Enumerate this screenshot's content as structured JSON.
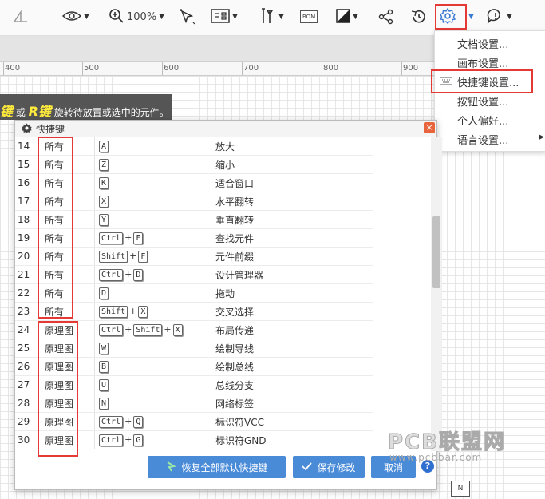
{
  "toolbar": {
    "zoom": "100%",
    "bom_label": "BOM"
  },
  "hint": {
    "key1": "键",
    "conj": " 或 ",
    "key2": "R键",
    "text": " 旋转待放置或选中的元件。"
  },
  "ruler": {
    "labels": [
      "400",
      "500",
      "600",
      "700",
      "800",
      "900"
    ]
  },
  "menu": {
    "items": [
      {
        "label": "文档设置..."
      },
      {
        "label": "画布设置..."
      },
      {
        "label": "快捷键设置..."
      },
      {
        "label": "按钮设置..."
      },
      {
        "label": "个人偏好..."
      },
      {
        "label": "语言设置..."
      }
    ]
  },
  "dialog": {
    "title": "快捷键",
    "close": "×",
    "rows": [
      {
        "id": "14",
        "scope": "所有",
        "keys": [
          "A"
        ],
        "action": "放大"
      },
      {
        "id": "15",
        "scope": "所有",
        "keys": [
          "Z"
        ],
        "action": "缩小"
      },
      {
        "id": "16",
        "scope": "所有",
        "keys": [
          "K"
        ],
        "action": "适合窗口"
      },
      {
        "id": "17",
        "scope": "所有",
        "keys": [
          "X"
        ],
        "action": "水平翻转"
      },
      {
        "id": "18",
        "scope": "所有",
        "keys": [
          "Y"
        ],
        "action": "垂直翻转"
      },
      {
        "id": "19",
        "scope": "所有",
        "keys": [
          "Ctrl",
          "F"
        ],
        "action": "查找元件"
      },
      {
        "id": "20",
        "scope": "所有",
        "keys": [
          "Shift",
          "F"
        ],
        "action": "元件前缀"
      },
      {
        "id": "21",
        "scope": "所有",
        "keys": [
          "Ctrl",
          "D"
        ],
        "action": "设计管理器"
      },
      {
        "id": "22",
        "scope": "所有",
        "keys": [
          "D"
        ],
        "action": "拖动"
      },
      {
        "id": "23",
        "scope": "所有",
        "keys": [
          "Shift",
          "X"
        ],
        "action": "交叉选择"
      },
      {
        "id": "24",
        "scope": "原理图",
        "keys": [
          "Ctrl",
          "Shift",
          "X"
        ],
        "action": "布局传递"
      },
      {
        "id": "25",
        "scope": "原理图",
        "keys": [
          "W"
        ],
        "action": "绘制导线"
      },
      {
        "id": "26",
        "scope": "原理图",
        "keys": [
          "B"
        ],
        "action": "绘制总线"
      },
      {
        "id": "27",
        "scope": "原理图",
        "keys": [
          "U"
        ],
        "action": "总线分支"
      },
      {
        "id": "28",
        "scope": "原理图",
        "keys": [
          "N"
        ],
        "action": "网络标签"
      },
      {
        "id": "29",
        "scope": "原理图",
        "keys": [
          "Ctrl",
          "Q"
        ],
        "action": "标识符VCC"
      },
      {
        "id": "30",
        "scope": "原理图",
        "keys": [
          "Ctrl",
          "G"
        ],
        "action": "标识符GND"
      }
    ],
    "buttons": {
      "restore": "恢复全部默认快捷键",
      "save": "保存修改",
      "cancel": "取消"
    }
  },
  "watermark": {
    "brand": "PCB联盟网",
    "url": "www.pcbbar.com"
  },
  "colors": {
    "accent": "#4a8bd8",
    "highlight": "#e53935"
  }
}
